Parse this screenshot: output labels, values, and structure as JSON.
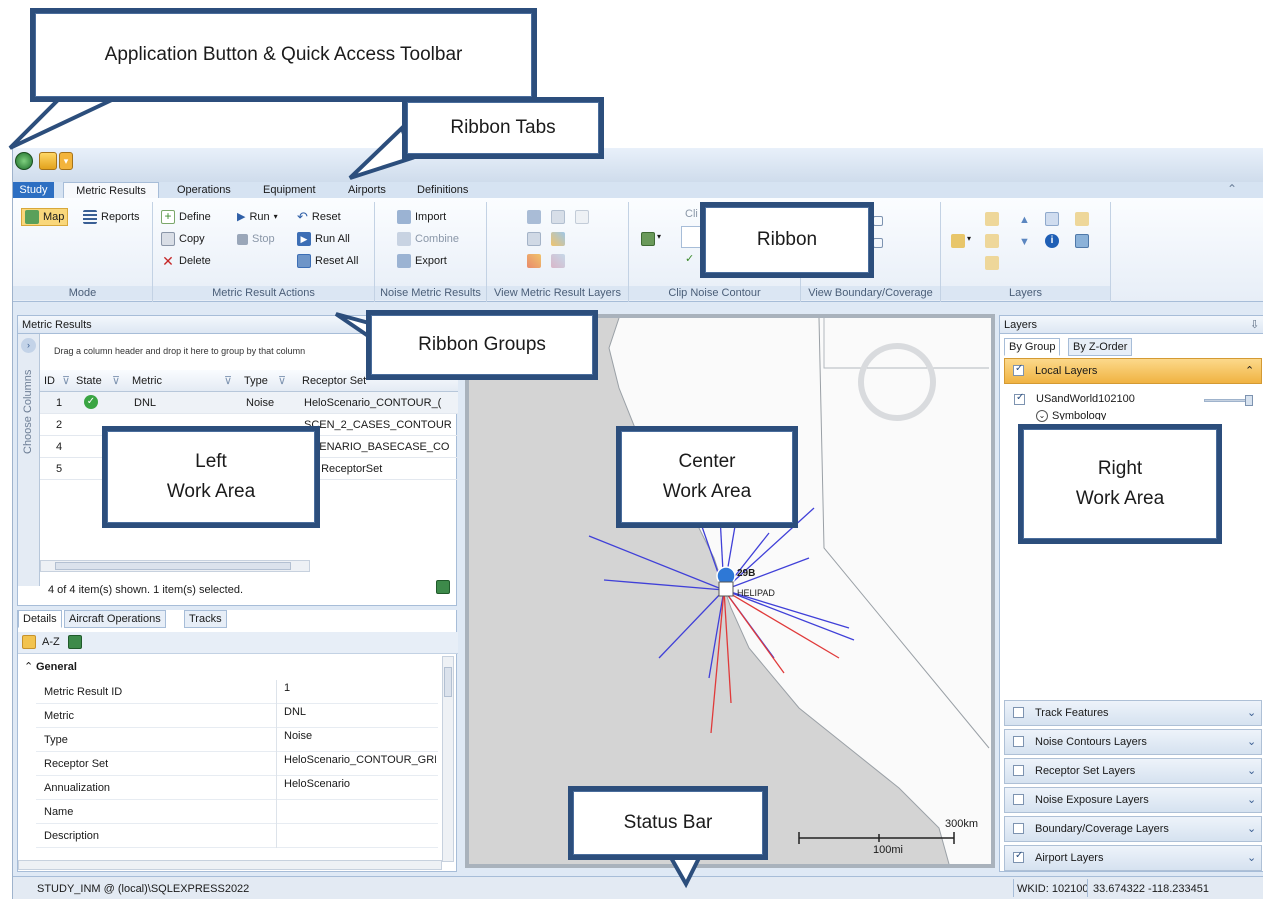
{
  "callouts": {
    "qat": "Application Button & Quick Access Toolbar",
    "tabs": "Ribbon Tabs",
    "ribbon": "Ribbon",
    "groups": "Ribbon Groups",
    "left_line1": "Left",
    "left_line2": "Work Area",
    "center_line1": "Center",
    "center_line2": "Work Area",
    "right_line1": "Right",
    "right_line2": "Work Area",
    "status": "Status Bar"
  },
  "tabs": [
    "Study",
    "Metric Results",
    "Operations",
    "Equipment",
    "Airports",
    "Definitions"
  ],
  "ribbon": {
    "mode": {
      "map": "Map",
      "reports": "Reports",
      "label": "Mode"
    },
    "actions": {
      "define": "Define",
      "copy": "Copy",
      "delete": "Delete",
      "run": "Run",
      "stop": "Stop",
      "reset": "Reset",
      "run_all": "Run All",
      "reset_all": "Reset All",
      "label": "Metric Result Actions"
    },
    "noise": {
      "import": "Import",
      "combine": "Combine",
      "export": "Export",
      "label": "Noise Metric Results"
    },
    "view_layers_label": "View Metric Result Layers",
    "clip_label": "Clip Noise Contour",
    "clip_partial": "Cli",
    "boundary_label": "View Boundary/Coverage",
    "layers_label": "Layers"
  },
  "metric_results": {
    "title": "Metric Results",
    "choose_columns": "Choose Columns",
    "group_hint": "Drag a column header and drop it here to group by that column",
    "columns": [
      "ID",
      "State",
      "Metric",
      "Type",
      "Receptor Set"
    ],
    "rows": [
      {
        "id": "1",
        "metric": "DNL",
        "type": "Noise",
        "receptor": "HeloScenario_CONTOUR_("
      },
      {
        "id": "2",
        "metric": "",
        "type": "",
        "receptor": "SCEN_2_CASES_CONTOUR"
      },
      {
        "id": "4",
        "metric": "",
        "type": "",
        "receptor": "SCENARIO_BASECASE_CO"
      },
      {
        "id": "5",
        "metric": "",
        "type": "",
        "receptor": "No ReceptorSet"
      }
    ],
    "footer": "4 of 4 item(s) shown. 1 item(s) selected."
  },
  "details": {
    "tabs": [
      "Details",
      "Aircraft Operations",
      "Tracks"
    ],
    "sort_az": "A-Z",
    "section": "General",
    "props": [
      {
        "name": "Metric Result ID",
        "value": "1"
      },
      {
        "name": "Metric",
        "value": "DNL"
      },
      {
        "name": "Type",
        "value": "Noise"
      },
      {
        "name": "Receptor Set",
        "value": "HeloScenario_CONTOUR_GRI"
      },
      {
        "name": "Annualization",
        "value": "HeloScenario"
      },
      {
        "name": "Name",
        "value": ""
      },
      {
        "name": "Description",
        "value": ""
      }
    ]
  },
  "map": {
    "airport_code": "29B",
    "airport_label": "HELIPAD",
    "scale_km": "300km",
    "scale_mi": "100mi"
  },
  "layers": {
    "title": "Layers",
    "pin": "ᵖ",
    "tabs": [
      "By Group",
      "By Z-Order"
    ],
    "local": "Local Layers",
    "basemap": "USandWorld102100",
    "symbology": "Symbology",
    "groups": [
      "Track Features",
      "Noise Contours Layers",
      "Receptor Set Layers",
      "Noise Exposure Layers",
      "Boundary/Coverage Layers",
      "Airport Layers"
    ]
  },
  "status": {
    "left": "STUDY_INM @ (local)\\SQLEXPRESS2022",
    "wkid": "WKID: 102100",
    "coords": "33.674322 -118.233451"
  }
}
